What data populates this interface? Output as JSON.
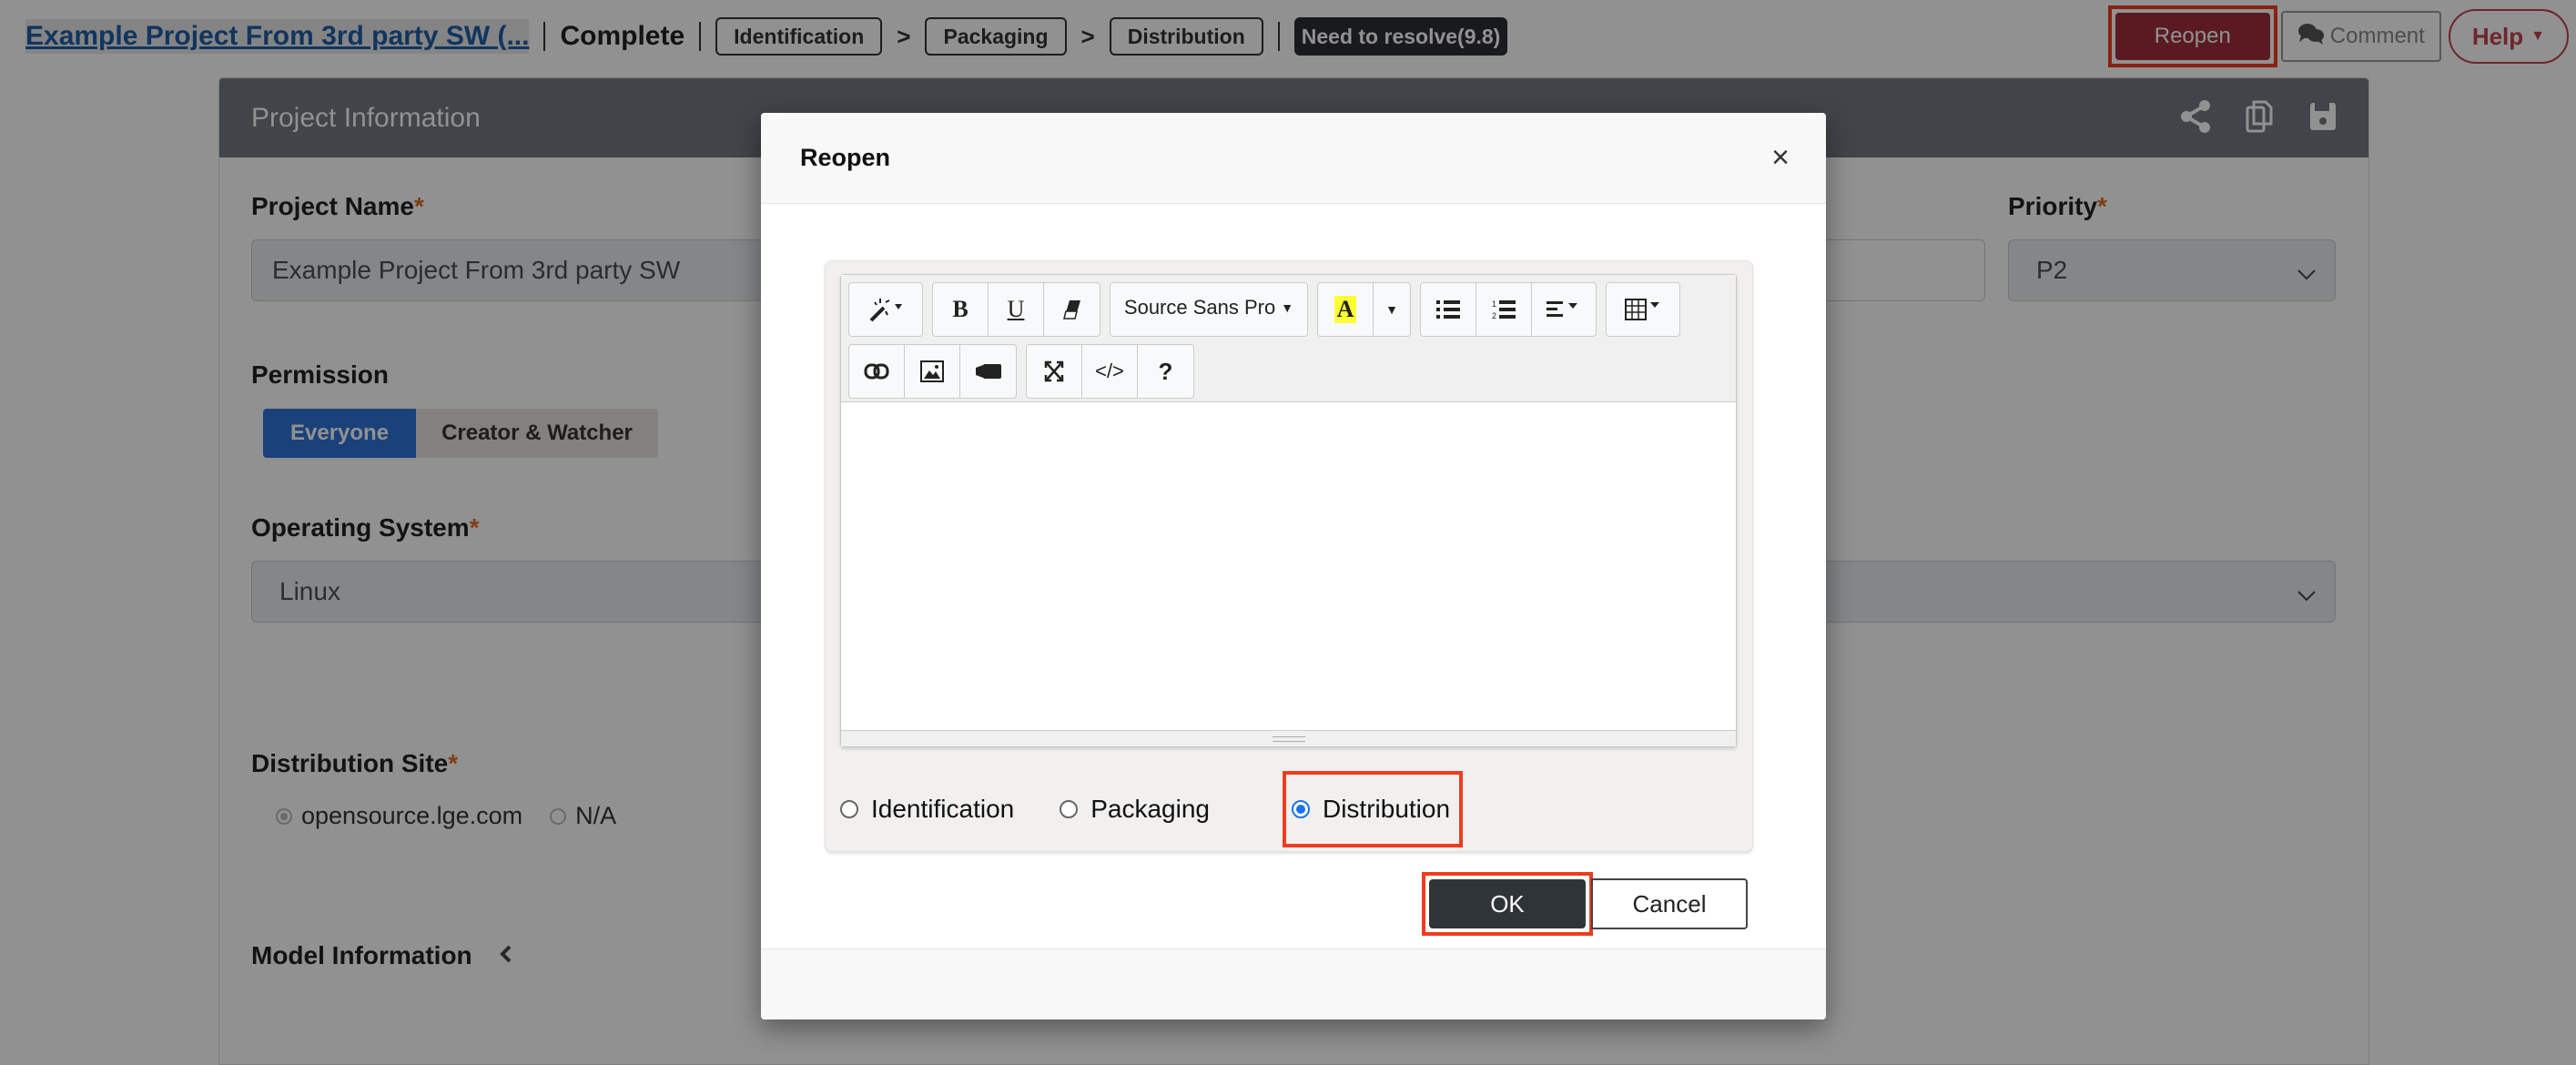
{
  "topbar": {
    "project_link": "Example Project From 3rd party SW (...",
    "status": "Complete",
    "stages": [
      "Identification",
      "Packaging",
      "Distribution"
    ],
    "stage_separator": ">",
    "resolve_badge": "Need to resolve(9.8)",
    "reopen_label": "Reopen",
    "comment_label": "Comment",
    "help_label": "Help"
  },
  "panel": {
    "title": "Project Information",
    "project_name_label": "Project Name",
    "project_name_value": "Example Project From 3rd party SW",
    "priority_label": "Priority",
    "priority_value": "P2",
    "permission_label": "Permission",
    "permission_options": [
      "Everyone",
      "Creator & Watcher"
    ],
    "permission_selected": "Everyone",
    "os_label": "Operating System",
    "os_value": "Linux",
    "dist_site_label": "Distribution Site",
    "dist_site_options": [
      "opensource.lge.com",
      "N/A"
    ],
    "dist_site_selected": "opensource.lge.com",
    "model_info_label": "Model Information",
    "required_mark": "*"
  },
  "modal": {
    "title": "Reopen",
    "close_glyph": "×",
    "toolbar": {
      "font_name": "Source Sans Pro",
      "bold": "B",
      "underline": "U",
      "highlight_glyph": "A",
      "code_glyph": "</>",
      "help_glyph": "?"
    },
    "editor_content": "",
    "stage_options": [
      "Identification",
      "Packaging",
      "Distribution"
    ],
    "stage_selected": "Distribution",
    "ok_label": "OK",
    "cancel_label": "Cancel"
  },
  "colors": {
    "accent_blue": "#2e73d6",
    "reopen_red": "#a02c3c",
    "highlight_box": "#f03c1e",
    "required": "#e26d2b",
    "ok_dark": "#2f3439"
  }
}
